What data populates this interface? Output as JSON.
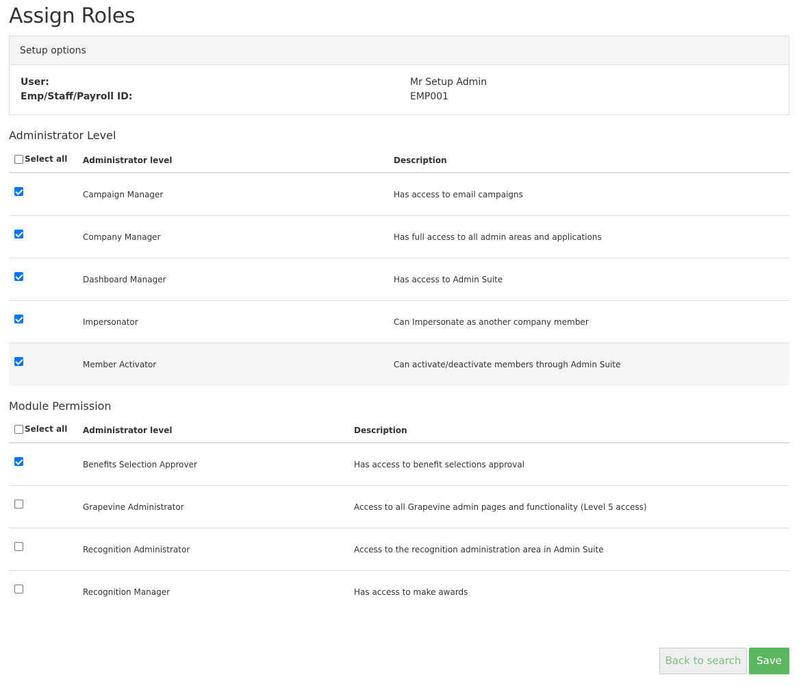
{
  "page": {
    "title": "Assign Roles"
  },
  "setup": {
    "heading": "Setup options",
    "user_label": "User:",
    "user_value": "Mr Setup Admin",
    "id_label": "Emp/Staff/Payroll ID:",
    "id_value": "EMP001"
  },
  "admin_section": {
    "title": "Administrator Level",
    "select_all_label": "Select all",
    "col_level": "Administrator level",
    "col_description": "Description",
    "rows": [
      {
        "name": "Campaign Manager",
        "description": "Has access to email campaigns",
        "checked": true
      },
      {
        "name": "Company Manager",
        "description": "Has full access to all admin areas and applications",
        "checked": true
      },
      {
        "name": "Dashboard Manager",
        "description": "Has access to Admin Suite",
        "checked": true
      },
      {
        "name": "Impersonator",
        "description": "Can Impersonate as another company member",
        "checked": true
      },
      {
        "name": "Member Activator",
        "description": "Can activate/deactivate members through Admin Suite",
        "checked": true
      }
    ]
  },
  "module_section": {
    "title": "Module Permission",
    "select_all_label": "Select all",
    "col_level": "Administrator level",
    "col_description": "Description",
    "rows": [
      {
        "name": "Benefits Selection Approver",
        "description": "Has access to benefit selections approval",
        "checked": true
      },
      {
        "name": "Grapevine Administrator",
        "description": "Access to all Grapevine admin pages and functionality (Level 5 access)",
        "checked": false
      },
      {
        "name": "Recognition Administrator",
        "description": "Access to the recognition administration area in Admin Suite",
        "checked": false
      },
      {
        "name": "Recognition Manager",
        "description": "Has access to make awards",
        "checked": false
      }
    ]
  },
  "buttons": {
    "back_label": "Back to search",
    "save_label": "Save"
  },
  "colors": {
    "accent_green": "#5cb660",
    "checkbox_blue": "#0075ff"
  }
}
